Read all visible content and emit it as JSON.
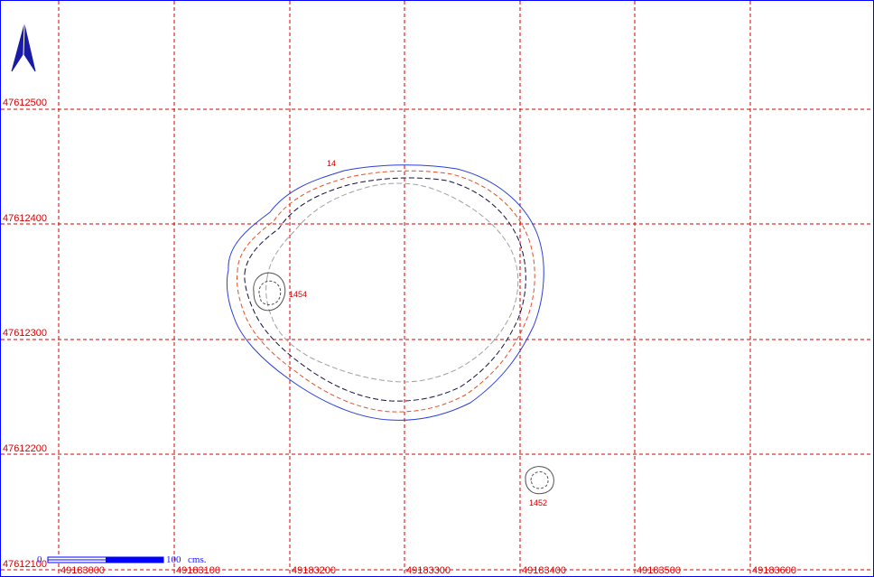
{
  "colors": {
    "grid": "#d40000",
    "contour_outer": "#2a3fd8",
    "contour_red": "#e0502a",
    "contour_dark": "#101040",
    "contour_grey": "#a0a0a0",
    "north_arrow": "#1a1aa8",
    "scale_bar": "#0000ff"
  },
  "grid": {
    "x_labels": [
      "49183000",
      "49183100",
      "49183200",
      "49183300",
      "49183400",
      "49183500",
      "49183600"
    ],
    "y_labels": [
      "47612500",
      "47612400",
      "47612300",
      "47612200",
      "47612100"
    ]
  },
  "features": {
    "main_label": "14",
    "small_1_label": "1454",
    "small_2_label": "1452"
  },
  "scale": {
    "zero_label": "0",
    "end_label": "100",
    "unit_label": "cms."
  },
  "north_arrow": {
    "icon": "north-arrow-icon"
  }
}
